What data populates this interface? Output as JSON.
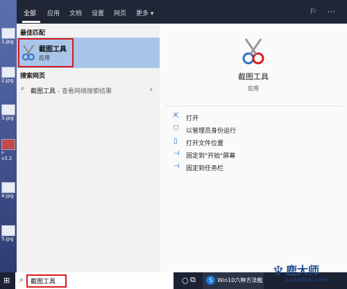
{
  "desktop": {
    "items": [
      {
        "label": "1.jpg"
      },
      {
        "label": "2.jpg"
      },
      {
        "label": "3.jpg"
      },
      {
        "label": "r-v3.2"
      },
      {
        "label": "4.jpg"
      },
      {
        "label": "5.jpg"
      }
    ]
  },
  "tabs": {
    "all": "全部",
    "apps": "应用",
    "docs": "文档",
    "settings": "设置",
    "web": "网页",
    "more": "更多"
  },
  "left": {
    "best_match_header": "最佳匹配",
    "best_match_title": "截图工具",
    "best_match_type": "应用",
    "web_header": "搜索网页",
    "web_query": "截图工具",
    "web_hint": " - 查看网络搜索结果"
  },
  "right": {
    "app_title": "截图工具",
    "app_type": "应用",
    "actions": {
      "open": "打开",
      "run_admin": "以管理员身份运行",
      "open_location": "打开文件位置",
      "pin_start": "固定到\"开始\"屏幕",
      "pin_taskbar": "固定到任务栏"
    }
  },
  "taskbar": {
    "search_value": "截图工具",
    "app_label": "Win10六种方法截"
  },
  "watermark": {
    "title": "鹿大师",
    "subtitle": "Ludashiwj.com"
  },
  "colors": {
    "topbar": "#202636",
    "selection": "#a9c6e8",
    "highlight_box": "#d9191b",
    "accent": "#2d6fc4"
  }
}
